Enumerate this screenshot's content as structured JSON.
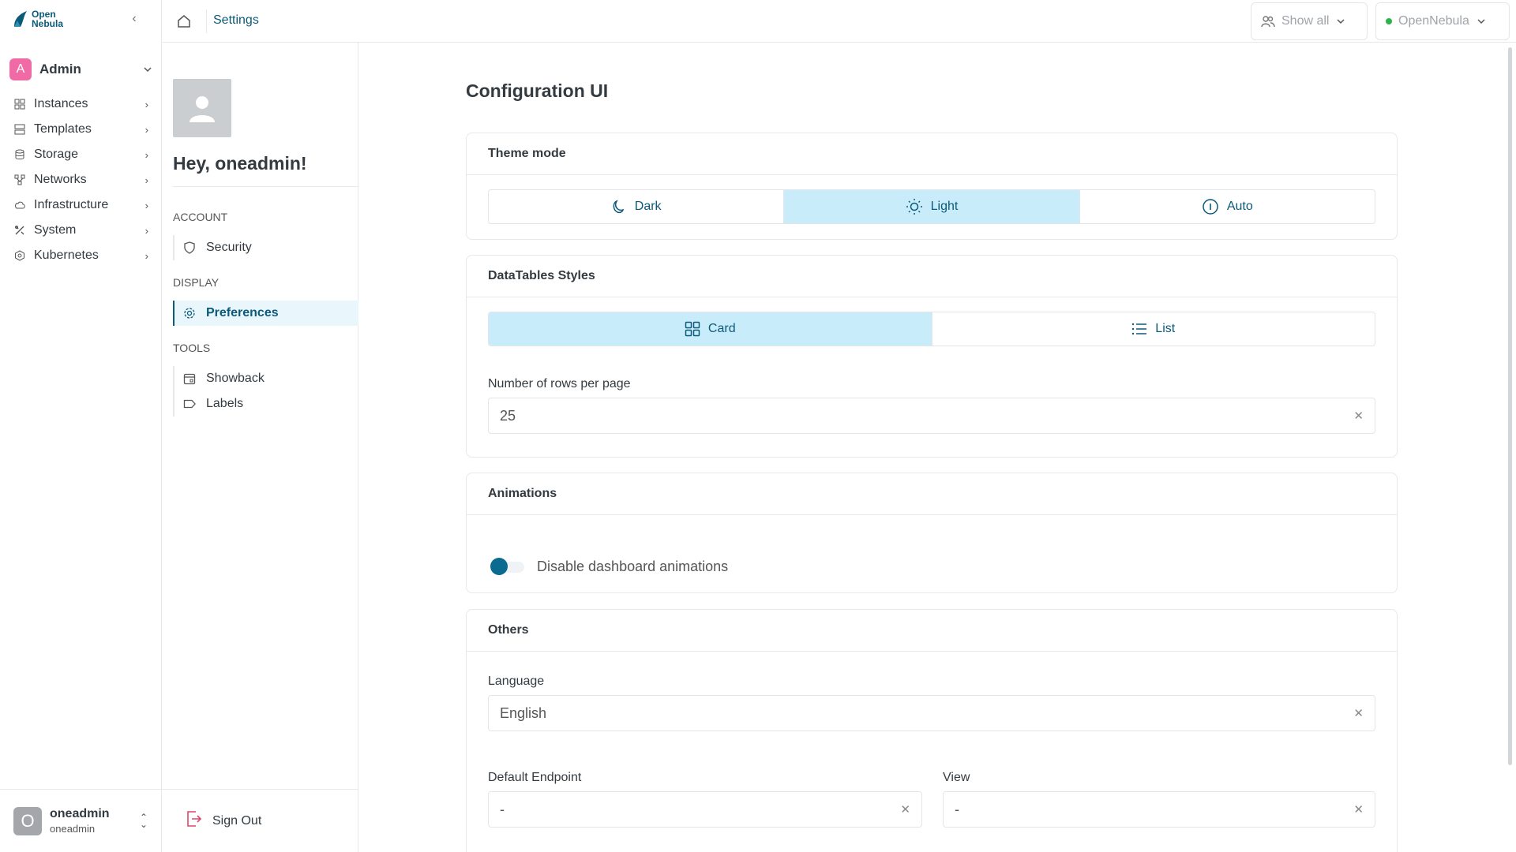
{
  "brand": {
    "line1": "Open",
    "line2": "Nebula"
  },
  "sidebar": {
    "group": {
      "avatar_letter": "A",
      "name": "Admin"
    },
    "items": [
      {
        "label": "Instances",
        "icon": "instances-icon"
      },
      {
        "label": "Templates",
        "icon": "templates-icon"
      },
      {
        "label": "Storage",
        "icon": "storage-icon"
      },
      {
        "label": "Networks",
        "icon": "networks-icon"
      },
      {
        "label": "Infrastructure",
        "icon": "cloud-icon"
      },
      {
        "label": "System",
        "icon": "tools-icon"
      },
      {
        "label": "Kubernetes",
        "icon": "kubernetes-icon"
      }
    ],
    "user": {
      "avatar_letter": "O",
      "name": "oneadmin",
      "sub": "oneadmin"
    }
  },
  "topbar": {
    "breadcrumb": "Settings",
    "show_all": "Show all",
    "zone": "OpenNebula"
  },
  "settings_nav": {
    "greeting": "Hey, oneadmin!",
    "sections": {
      "account": {
        "title": "ACCOUNT",
        "items": [
          {
            "label": "Security"
          }
        ]
      },
      "display": {
        "title": "DISPLAY",
        "items": [
          {
            "label": "Preferences"
          }
        ]
      },
      "tools": {
        "title": "TOOLS",
        "items": [
          {
            "label": "Showback"
          },
          {
            "label": "Labels"
          }
        ]
      }
    },
    "sign_out": "Sign Out"
  },
  "main": {
    "title": "Configuration UI",
    "theme": {
      "title": "Theme mode",
      "options": [
        {
          "label": "Dark"
        },
        {
          "label": "Light"
        },
        {
          "label": "Auto"
        }
      ],
      "selected": "Light"
    },
    "datatables": {
      "title": "DataTables Styles",
      "options": [
        {
          "label": "Card"
        },
        {
          "label": "List"
        }
      ],
      "selected": "Card",
      "rows_label": "Number of rows per page",
      "rows_value": "25"
    },
    "animations": {
      "title": "Animations",
      "toggle_label": "Disable dashboard animations"
    },
    "others": {
      "title": "Others",
      "language_label": "Language",
      "language_value": "English",
      "endpoint_label": "Default Endpoint",
      "endpoint_value": "-",
      "view_label": "View",
      "view_value": "-"
    }
  },
  "colors": {
    "accent": "#0b5a7a",
    "selected_segment": "#c9ecfb",
    "group_avatar": "#f06aa5",
    "status_dot": "#2cb34a"
  }
}
